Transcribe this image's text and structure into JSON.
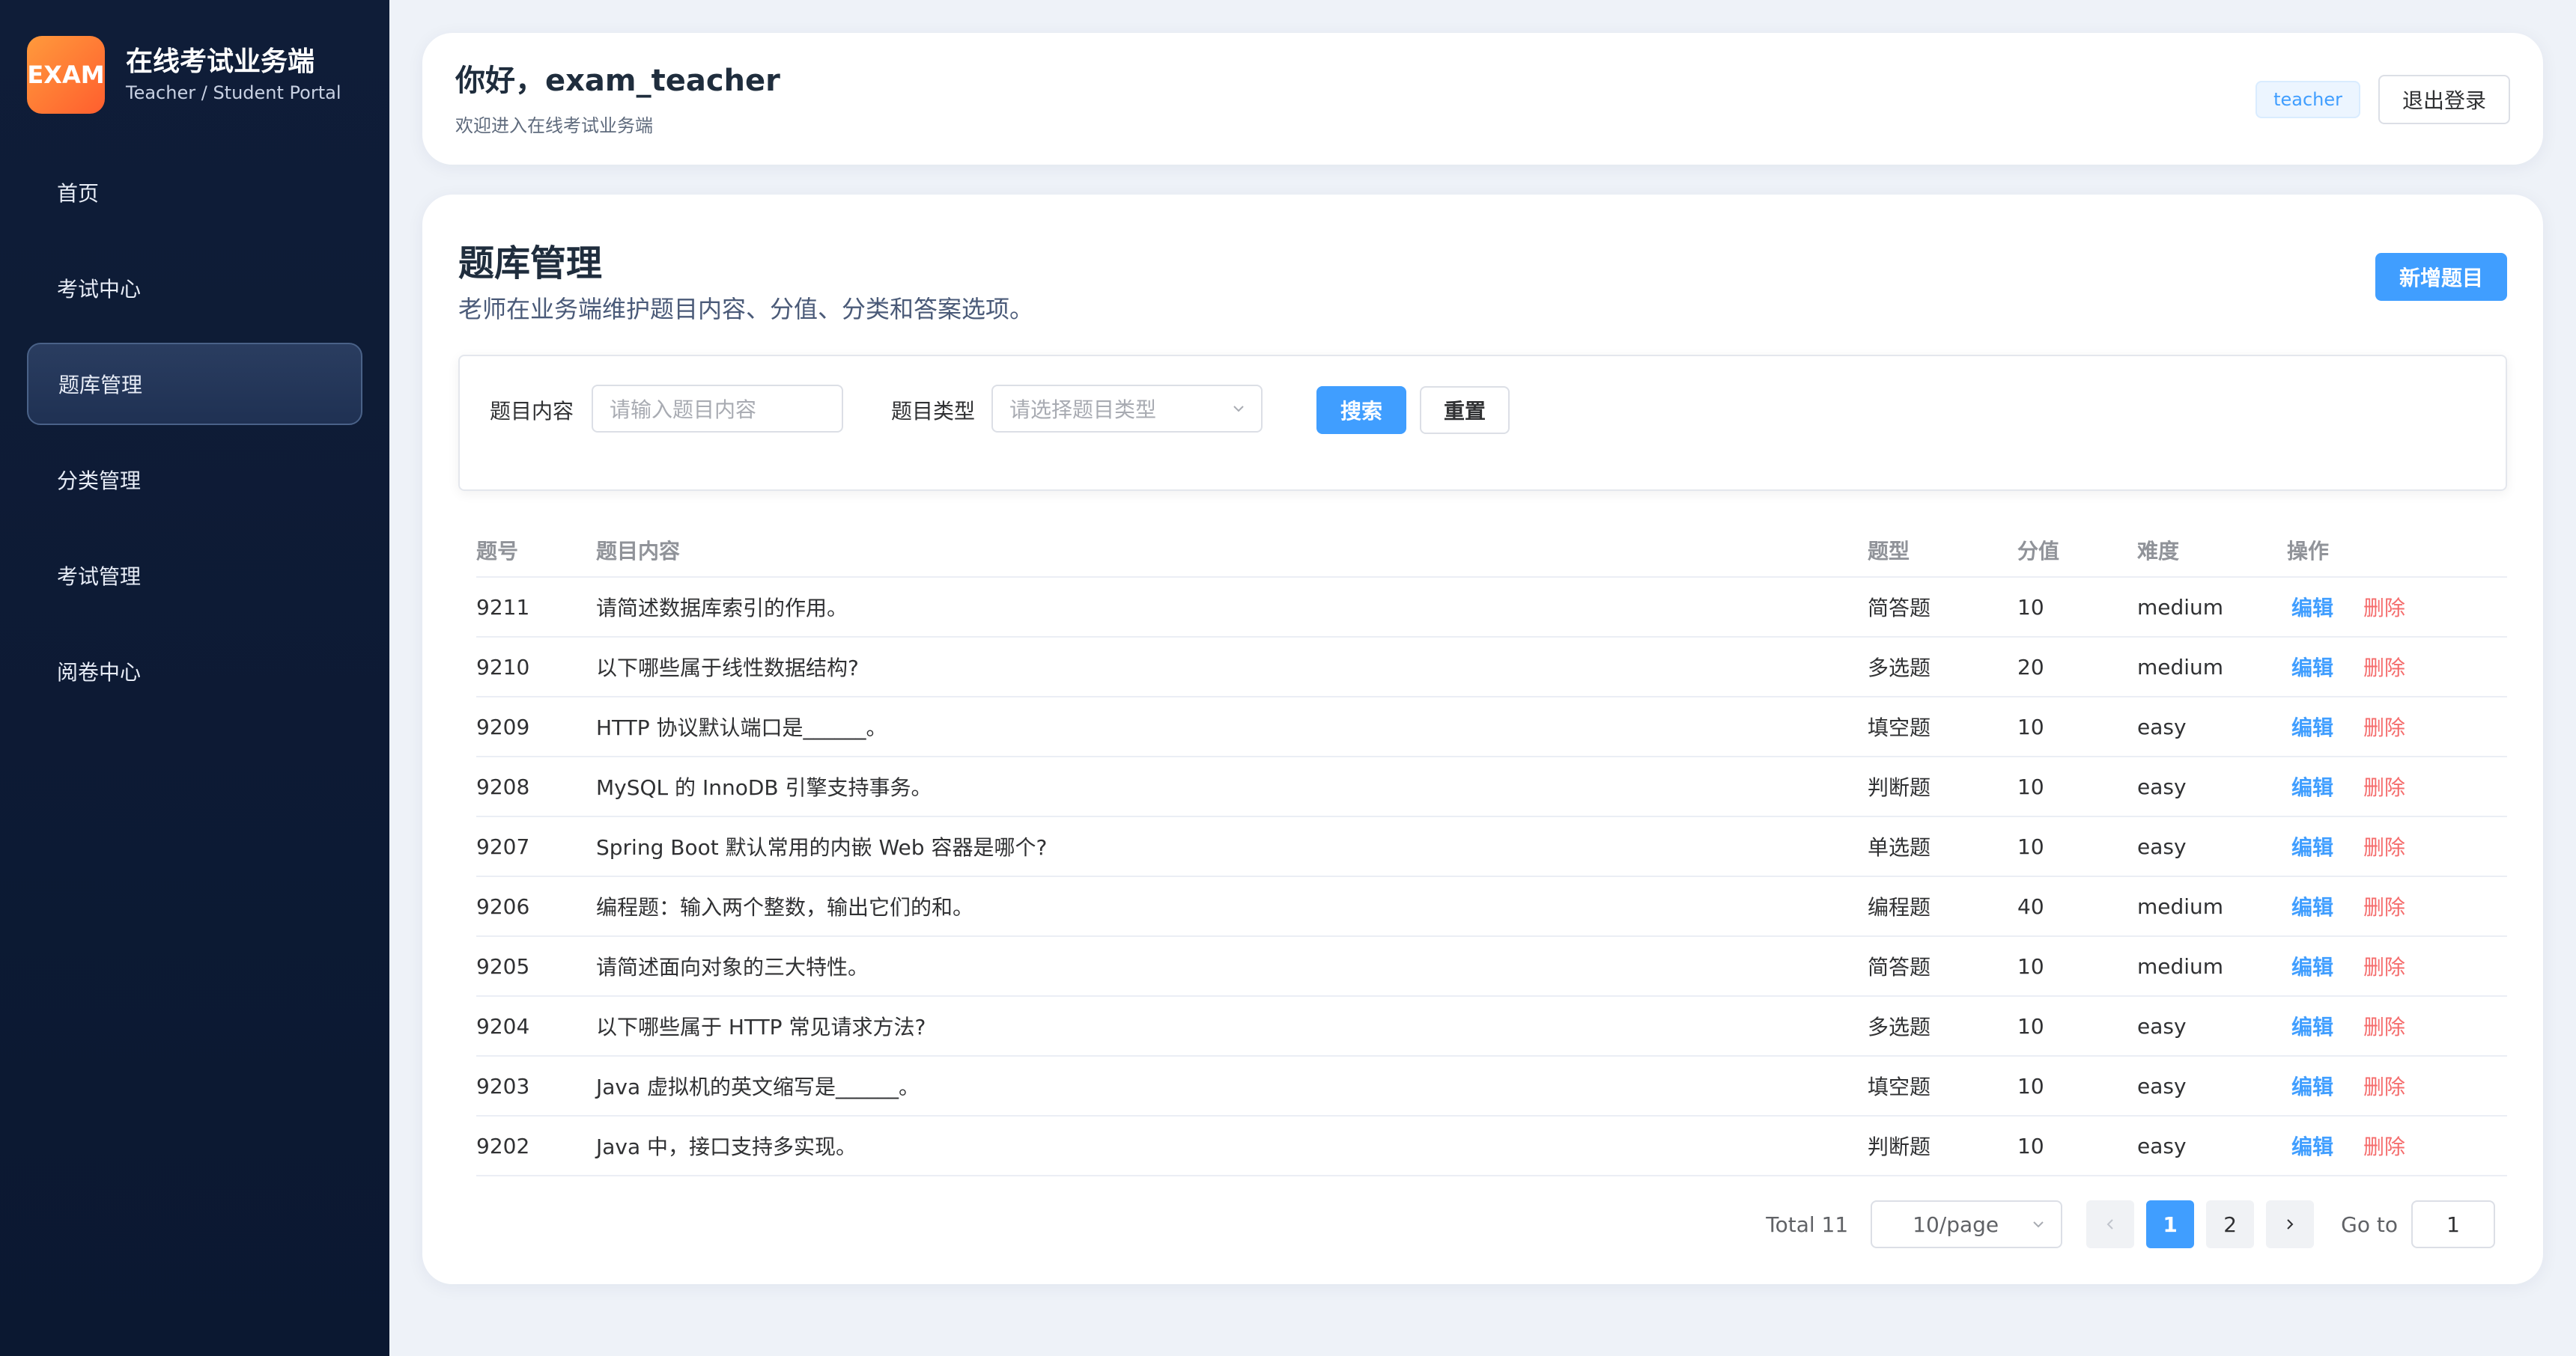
{
  "brand": {
    "logo_text": "EXAM",
    "title": "在线考试业务端",
    "subtitle": "Teacher / Student Portal"
  },
  "sidebar": {
    "items": [
      {
        "label": "首页"
      },
      {
        "label": "考试中心"
      },
      {
        "label": "题库管理",
        "active": true
      },
      {
        "label": "分类管理"
      },
      {
        "label": "考试管理"
      },
      {
        "label": "阅卷中心"
      }
    ]
  },
  "header": {
    "greeting": "你好，exam_teacher",
    "subtitle": "欢迎进入在线考试业务端",
    "role": "teacher",
    "logout_label": "退出登录"
  },
  "main": {
    "title": "题库管理",
    "description": "老师在业务端维护题目内容、分值、分类和答案选项。",
    "add_label": "新增题目"
  },
  "search": {
    "content_label": "题目内容",
    "content_placeholder": "请输入题目内容",
    "type_label": "题目类型",
    "type_placeholder": "请选择题目类型",
    "search_label": "搜索",
    "reset_label": "重置"
  },
  "table": {
    "headers": {
      "id": "题号",
      "content": "题目内容",
      "type": "题型",
      "score": "分值",
      "difficulty": "难度",
      "ops": "操作"
    },
    "edit_label": "编辑",
    "delete_label": "删除",
    "rows": [
      {
        "id": "9211",
        "content": "请简述数据库索引的作用。",
        "type": "简答题",
        "score": "10",
        "difficulty": "medium"
      },
      {
        "id": "9210",
        "content": "以下哪些属于线性数据结构?",
        "type": "多选题",
        "score": "20",
        "difficulty": "medium"
      },
      {
        "id": "9209",
        "content": "HTTP 协议默认端口是______。",
        "type": "填空题",
        "score": "10",
        "difficulty": "easy"
      },
      {
        "id": "9208",
        "content": "MySQL 的 InnoDB 引擎支持事务。",
        "type": "判断题",
        "score": "10",
        "difficulty": "easy"
      },
      {
        "id": "9207",
        "content": "Spring Boot 默认常用的内嵌 Web 容器是哪个?",
        "type": "单选题",
        "score": "10",
        "difficulty": "easy"
      },
      {
        "id": "9206",
        "content": "编程题：输入两个整数，输出它们的和。",
        "type": "编程题",
        "score": "40",
        "difficulty": "medium"
      },
      {
        "id": "9205",
        "content": "请简述面向对象的三大特性。",
        "type": "简答题",
        "score": "10",
        "difficulty": "medium"
      },
      {
        "id": "9204",
        "content": "以下哪些属于 HTTP 常见请求方法?",
        "type": "多选题",
        "score": "10",
        "difficulty": "easy"
      },
      {
        "id": "9203",
        "content": "Java 虚拟机的英文缩写是______。",
        "type": "填空题",
        "score": "10",
        "difficulty": "easy"
      },
      {
        "id": "9202",
        "content": "Java 中，接口支持多实现。",
        "type": "判断题",
        "score": "10",
        "difficulty": "easy"
      }
    ]
  },
  "pagination": {
    "total_label": "Total 11",
    "page_size": "10/page",
    "pages": [
      "1",
      "2"
    ],
    "current": "1",
    "goto_label": "Go to",
    "goto_value": "1"
  },
  "colors": {
    "primary": "#409eff",
    "danger": "#f56c6c",
    "sidebar": "#0f1d38",
    "logo": "#ff7a35"
  }
}
